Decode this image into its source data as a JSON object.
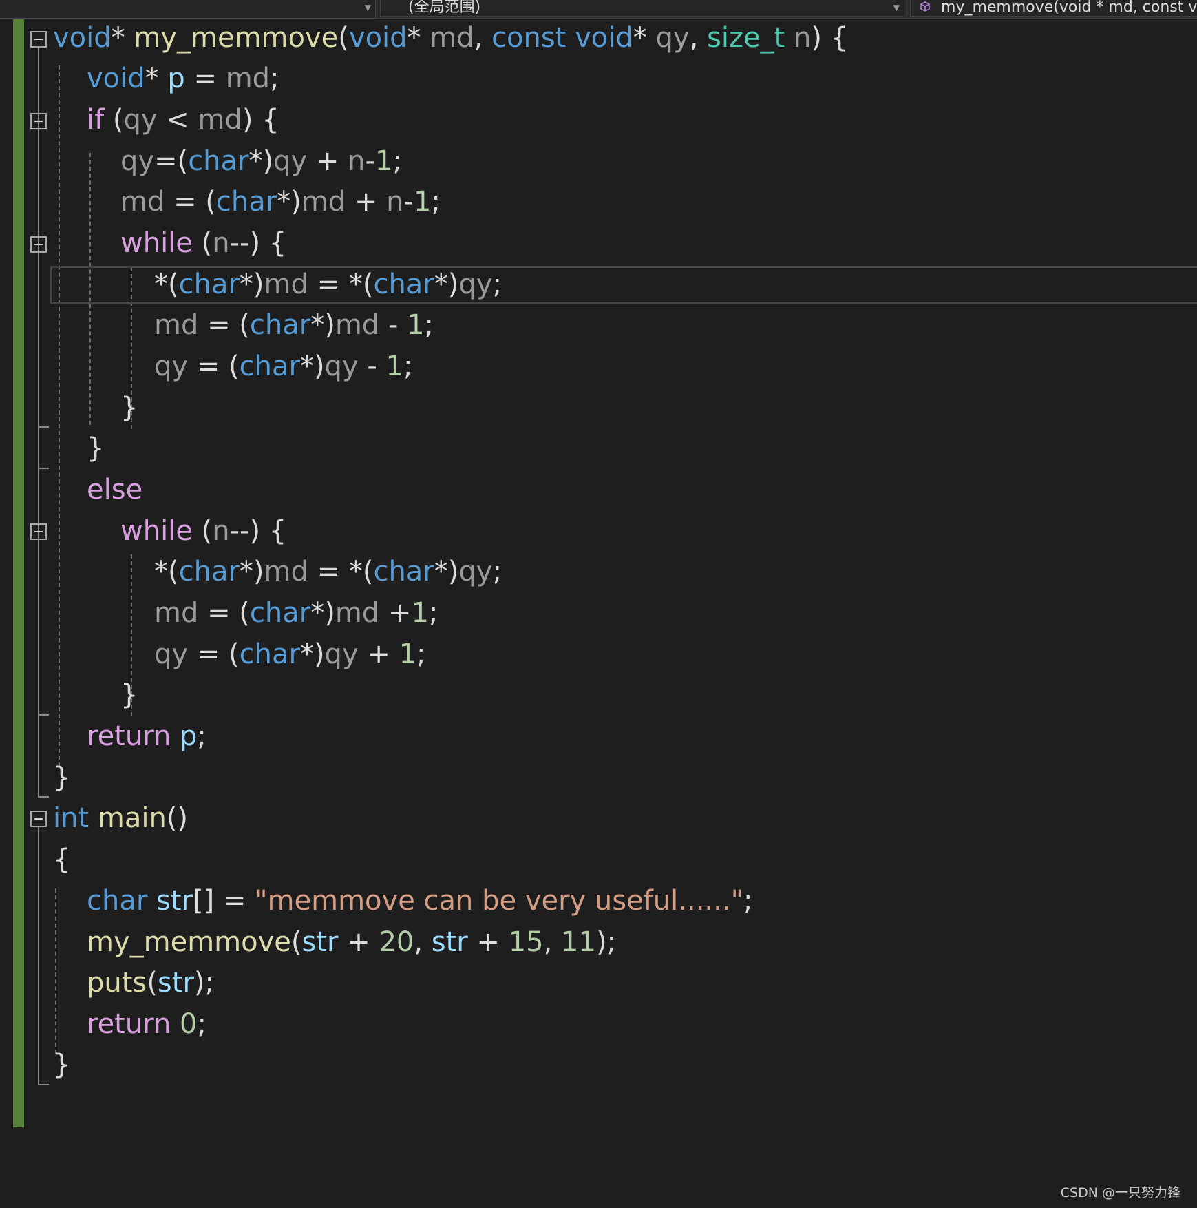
{
  "nav": {
    "left_value": "",
    "scope_value": "(全局范围)",
    "member_value": "my_memmove(void * md, const v"
  },
  "code": {
    "l1": {
      "a": "void",
      "b": "*",
      "c": "my_memmove",
      "d": "(",
      "e": "void",
      "f": "*",
      "g": " md",
      "h": ", ",
      "i": "const",
      "j": " ",
      "k": "void",
      "l": "*",
      "m": " qy",
      "n": ", ",
      "o": "size_t",
      "p": " n",
      "q": ") {"
    },
    "l2": {
      "a": "void",
      "b": "* ",
      "c": "p",
      "d": " = ",
      "e": "md",
      "f": ";"
    },
    "l3": {
      "a": "if",
      "b": " (",
      "c": "qy",
      "d": " < ",
      "e": "md",
      "f": ") {"
    },
    "l4": {
      "a": "qy",
      "b": "=(",
      "c": "char",
      "d": "*)",
      "e": "qy",
      "f": " + ",
      "g": "n",
      "h": "-",
      "i": "1",
      "j": ";"
    },
    "l5": {
      "a": "md",
      "b": " = (",
      "c": "char",
      "d": "*)",
      "e": "md",
      "f": " + ",
      "g": "n",
      "h": "-",
      "i": "1",
      "j": ";"
    },
    "l6": {
      "a": "while",
      "b": " (",
      "c": "n",
      "d": "--) {"
    },
    "l7": {
      "a": "*(",
      "b": "char",
      "c": "*)",
      "d": "md",
      "e": " = *(",
      "f": "char",
      "g": "*)",
      "h": "qy",
      "i": ";"
    },
    "l8": {
      "a": "md",
      "b": " = (",
      "c": "char",
      "d": "*)",
      "e": "md",
      "f": " - ",
      "g": "1",
      "h": ";"
    },
    "l9": {
      "a": "qy",
      "b": " = (",
      "c": "char",
      "d": "*)",
      "e": "qy",
      "f": " - ",
      "g": "1",
      "h": ";"
    },
    "l10": "}",
    "l11": "}",
    "l12": "else",
    "l13": {
      "a": "while",
      "b": " (",
      "c": "n",
      "d": "--) {"
    },
    "l14": {
      "a": "*(",
      "b": "char",
      "c": "*)",
      "d": "md",
      "e": " = *(",
      "f": "char",
      "g": "*)",
      "h": "qy",
      "i": ";"
    },
    "l15": {
      "a": "md",
      "b": " = (",
      "c": "char",
      "d": "*)",
      "e": "md",
      "f": " +",
      "g": "1",
      "h": ";"
    },
    "l16": {
      "a": "qy",
      "b": " = (",
      "c": "char",
      "d": "*)",
      "e": "qy",
      "f": " + ",
      "g": "1",
      "h": ";"
    },
    "l17": "}",
    "l18": {
      "a": "return",
      "b": " ",
      "c": "p",
      "d": ";"
    },
    "l19": "}",
    "l20": {
      "a": "int",
      "b": " ",
      "c": "main",
      "d": "()"
    },
    "l21": "{",
    "l22": {
      "a": "char",
      "b": " ",
      "c": "str",
      "d": "[] = ",
      "e": "\"memmove can be very useful......\"",
      "f": ";"
    },
    "l23": {
      "a": "my_memmove",
      "b": "(",
      "c": "str",
      "d": " + ",
      "e": "20",
      "f": ", ",
      "g": "str",
      "h": " + ",
      "i": "15",
      "j": ", ",
      "k": "11",
      "l": ");"
    },
    "l24": {
      "a": "puts",
      "b": "(",
      "c": "str",
      "d": ");"
    },
    "l25": {
      "a": "return",
      "b": " ",
      "c": "0",
      "d": ";"
    },
    "l26": "}"
  },
  "watermark": "CSDN @一只努力锋",
  "colors": {
    "background": "#1e1e1e",
    "keyword": "#569cd6",
    "control": "#d8a0df",
    "function": "#dcdcaa",
    "type": "#4ec9b0",
    "local": "#9cdcfe",
    "number": "#b5cea8",
    "string": "#d69d85",
    "change_bar": "#57803a"
  }
}
